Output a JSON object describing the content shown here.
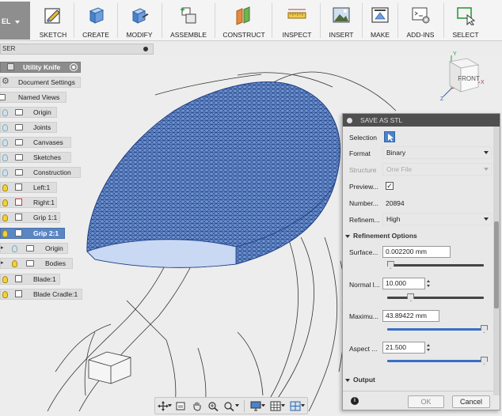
{
  "workspace": {
    "label": "EL"
  },
  "toolbar": [
    {
      "id": "sketch",
      "label": "SKETCH"
    },
    {
      "id": "create",
      "label": "CREATE"
    },
    {
      "id": "modify",
      "label": "MODIFY"
    },
    {
      "id": "assemble",
      "label": "ASSEMBLE"
    },
    {
      "id": "construct",
      "label": "CONSTRUCT"
    },
    {
      "id": "inspect",
      "label": "INSPECT"
    },
    {
      "id": "insert",
      "label": "INSERT"
    },
    {
      "id": "make",
      "label": "MAKE"
    },
    {
      "id": "addins",
      "label": "ADD-INS"
    },
    {
      "id": "select",
      "label": "SELECT"
    }
  ],
  "browser": {
    "header": "SER",
    "root": "Utility Knife",
    "items": [
      {
        "label": "Document Settings"
      },
      {
        "label": "Named Views"
      },
      {
        "label": "Origin"
      },
      {
        "label": "Joints"
      },
      {
        "label": "Canvases"
      },
      {
        "label": "Sketches"
      },
      {
        "label": "Construction"
      },
      {
        "label": "Left:1"
      },
      {
        "label": "Right:1"
      },
      {
        "label": "Grip 1:1"
      },
      {
        "label": "Grip 2:1"
      },
      {
        "label": "Origin"
      },
      {
        "label": "Bodies"
      },
      {
        "label": "Blade:1"
      },
      {
        "label": "Blade Cradle:1"
      }
    ]
  },
  "viewcube": {
    "face_label": "FRONT",
    "axis_x": "X",
    "axis_y": "Y",
    "axis_z": "Z"
  },
  "stl_dialog": {
    "title": "SAVE AS STL",
    "selection_label": "Selection",
    "format_label": "Format",
    "format_value": "Binary",
    "structure_label": "Structure",
    "structure_value": "One File",
    "preview_label": "Preview...",
    "preview_checked": "✓",
    "number_label": "Number...",
    "number_value": "20894",
    "refinement_label": "Refinem...",
    "refinement_value": "High",
    "refinement_options_label": "Refinement Options",
    "surface_label": "Surface...",
    "surface_value": "0.002200 mm",
    "surface_level": 0.03,
    "normal_label": "Normal l...",
    "normal_value": "10.000",
    "normal_level": 0.24,
    "maximum_label": "Maximu...",
    "maximum_value": "43.89422 mm",
    "maximum_level": 1.0,
    "aspect_label": "Aspect ...",
    "aspect_value": "21.500",
    "aspect_level": 1.0,
    "output_label": "Output",
    "ok_label": "OK",
    "cancel_label": "Cancel"
  }
}
